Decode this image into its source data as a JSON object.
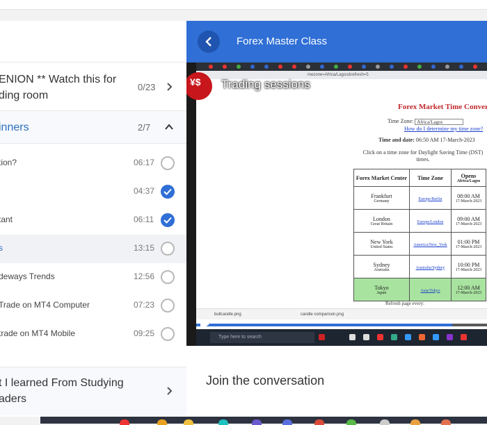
{
  "course": {
    "title": "Forex Master Class",
    "back_label": "Back"
  },
  "sections": [
    {
      "title_line1": "ENION ** Watch this for",
      "title_line2": "ding room",
      "count": "0/23",
      "expanded": false
    },
    {
      "title": "inners",
      "count": "2/7",
      "expanded": true
    },
    {
      "title_line1": "t I learned From Studying",
      "title_line2": "aders",
      "expanded": false
    }
  ],
  "lessons": [
    {
      "title": "tion?",
      "duration": "06:17",
      "status": "open"
    },
    {
      "title": "",
      "duration": "04:37",
      "status": "done"
    },
    {
      "title": "tant",
      "duration": "06:11",
      "status": "done"
    },
    {
      "title": "s",
      "duration": "13:15",
      "status": "open",
      "active": true
    },
    {
      "title": "deways Trends",
      "duration": "12:56",
      "status": "open"
    },
    {
      "title": "Trade on MT4 Computer",
      "duration": "07:23",
      "status": "open"
    },
    {
      "title": "trade on MT4 Mobile",
      "duration": "09:25",
      "status": "open"
    }
  ],
  "video": {
    "title": "Trading sessions",
    "url_fragment": "mezone=Africa/Lagos&refresh=5",
    "progress_fraction": 0.88,
    "page": {
      "heading": "Forex Market Time Convert",
      "time_zone_label": "Time Zone:",
      "time_zone_value": "Africa/Lagos",
      "help_link": "How do I determine my time zone?",
      "date_label": "Time and date:",
      "date_value": "06:50 AM 17-March-2023",
      "instruction": "Click on a time zone for Daylight Saving Time (DST) times.",
      "headers": [
        "Forex Market Center",
        "Time Zone",
        "Opens",
        "Africa/Lagos"
      ],
      "rows": [
        {
          "city": "Frankfurt",
          "country": "Germany",
          "zone": "Europe/Berlin",
          "open": "08:00 AM",
          "date": "17-March-2023"
        },
        {
          "city": "London",
          "country": "Great Britain",
          "zone": "Europe/London",
          "open": "09:00 AM",
          "date": "17-March-2023"
        },
        {
          "city": "New York",
          "country": "United States",
          "zone": "America/New_York",
          "open": "01:00 PM",
          "date": "17-March-2023"
        },
        {
          "city": "Sydney",
          "country": "Australia",
          "zone": "Australia/Sydney",
          "open": "10:00 PM",
          "date": "17-March-2023"
        },
        {
          "city": "Tokyo",
          "country": "Japan",
          "zone": "Asia/Tokyo",
          "open": "12:00 AM",
          "date": "17-March-2023",
          "highlight": true
        }
      ],
      "refresh": "Refresh page every:"
    },
    "downloads": [
      "bullcandle.png",
      "candle comparison.png"
    ],
    "taskbar_search": "Type here to search"
  },
  "conversation": {
    "heading": "Join the conversation"
  },
  "colors": {
    "accent": "#2f6fd6",
    "complete": "#2f6fd6",
    "active_row": "#f0f2f5",
    "logo_red": "#c7161c",
    "table_highlight": "#a9e3a0"
  },
  "icons": {
    "back": "chevron-left-icon",
    "section_collapsed": "chevron-right-icon",
    "section_expanded": "chevron-up-icon",
    "lesson_done": "check-circle-icon",
    "lesson_open": "empty-circle-icon",
    "play": "play-icon"
  }
}
